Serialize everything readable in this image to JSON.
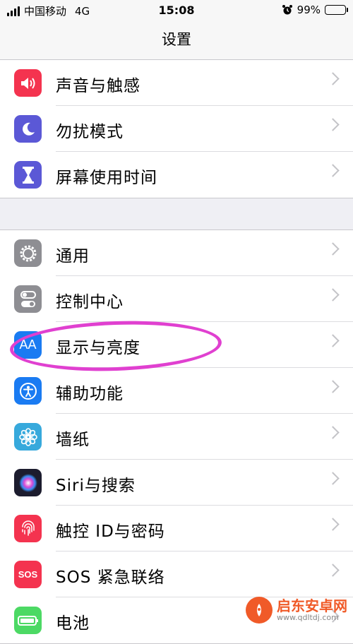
{
  "status_bar": {
    "carrier": "中国移动",
    "network": "4G",
    "time": "15:08",
    "battery": "99%",
    "battery_level": 0.99,
    "alarm_icon": "alarm-clock-icon"
  },
  "nav": {
    "title": "设置"
  },
  "groups": [
    {
      "items": [
        {
          "label": "声音与触感",
          "icon": "speaker-icon",
          "color": "#f4334f"
        },
        {
          "label": "勿扰模式",
          "icon": "moon-icon",
          "color": "#5b58d6"
        },
        {
          "label": "屏幕使用时间",
          "icon": "hourglass-icon",
          "color": "#5b58d6"
        }
      ]
    },
    {
      "items": [
        {
          "label": "通用",
          "icon": "gear-icon",
          "color": "#8e8e93"
        },
        {
          "label": "控制中心",
          "icon": "toggles-icon",
          "color": "#8e8e93"
        },
        {
          "label": "显示与亮度",
          "icon": "text-size-icon",
          "color": "#1a7bf2"
        },
        {
          "label": "辅助功能",
          "icon": "accessibility-icon",
          "color": "#1a7bf2"
        },
        {
          "label": "墙纸",
          "icon": "flower-icon",
          "color": "#37a9dc"
        },
        {
          "label": "Siri与搜索",
          "icon": "siri-icon",
          "color": "#1c1c2e"
        },
        {
          "label": "触控 ID与密码",
          "icon": "fingerprint-icon",
          "color": "#f4334f"
        },
        {
          "label": "SOS 紧急联络",
          "icon": "sos-icon",
          "color": "#f4334f"
        },
        {
          "label": "电池",
          "icon": "battery-icon",
          "color": "#4cd964"
        }
      ]
    }
  ],
  "icon_labels": {
    "text_size": "AA",
    "sos": "SOS"
  },
  "highlight_color": "#e040d0",
  "watermark": {
    "main": "启东安卓网",
    "sub": "www.qdltdj.com"
  }
}
